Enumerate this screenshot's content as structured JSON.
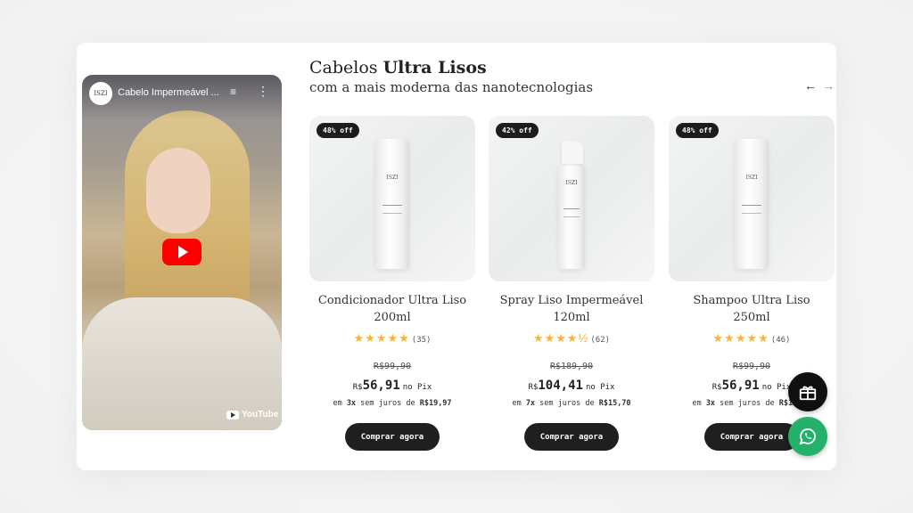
{
  "video": {
    "channel_avatar": "ISZI",
    "title": "Cabelo Impermeável ...",
    "queue_icon": "playlist-add-icon",
    "more_icon": "more-vertical-icon",
    "logo_text": "YouTube"
  },
  "heading": {
    "title_regular": "Cabelos ",
    "title_bold": "Ultra Lisos",
    "subtitle": "com a mais moderna das nanotecnologias"
  },
  "nav": {
    "prev": "←",
    "next": "→"
  },
  "products": [
    {
      "badge": "48% off",
      "brand": "ISZI",
      "name": "Condicionador Ultra Liso 200ml",
      "stars": "★★★★★",
      "rating": 5,
      "reviews": "(35)",
      "old_price": "R$99,90",
      "currency": "R$",
      "price": "56,91",
      "pix": "no Pix",
      "install_prefix": "em ",
      "install_count": "3x",
      "install_mid": " sem juros de ",
      "install_value": "R$19,97",
      "button": "Comprar agora"
    },
    {
      "badge": "42% off",
      "brand": "ISZI",
      "name": "Spray Liso Impermeável 120ml",
      "stars": "★★★★½",
      "rating": 4.5,
      "reviews": "(62)",
      "old_price": "R$189,90",
      "currency": "R$",
      "price": "104,41",
      "pix": "no Pix",
      "install_prefix": "em ",
      "install_count": "7x",
      "install_mid": " sem juros de ",
      "install_value": "R$15,70",
      "button": "Comprar agora"
    },
    {
      "badge": "48% off",
      "brand": "ISZI",
      "name": "Shampoo Ultra Liso 250ml",
      "stars": "★★★★★",
      "rating": 5,
      "reviews": "(46)",
      "old_price": "R$99,90",
      "currency": "R$",
      "price": "56,91",
      "pix": "no Pix",
      "install_prefix": "em ",
      "install_count": "3x",
      "install_mid": " sem juros de ",
      "install_value": "R$19,97",
      "button": "Comprar agora"
    }
  ],
  "floating": {
    "gift_icon": "gift-icon",
    "whatsapp_icon": "whatsapp-icon"
  },
  "colors": {
    "accent_dark": "#1f1f1f",
    "star": "#f4b63a",
    "whatsapp": "#25b06b",
    "youtube_red": "#ff0000"
  }
}
